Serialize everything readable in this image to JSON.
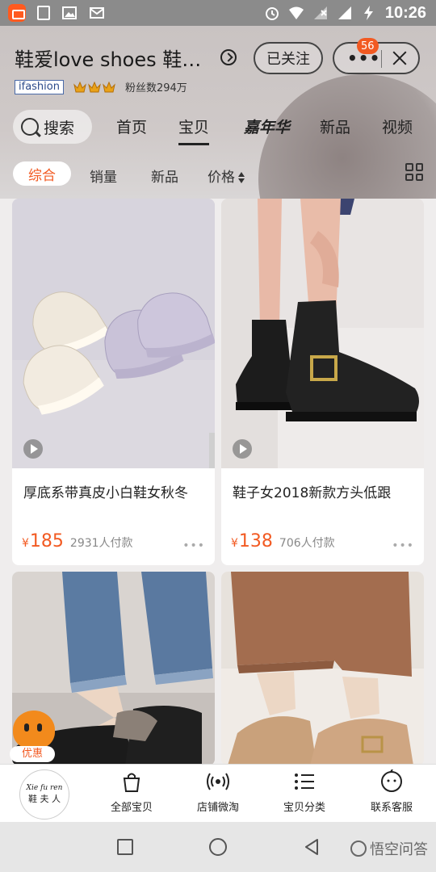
{
  "status_bar": {
    "time": "10:26"
  },
  "store": {
    "name": "鞋爱love shoes 鞋夫人",
    "follow_label": "已关注",
    "badge_count": "56",
    "tag": "ifashion",
    "fans": "粉丝数294万"
  },
  "nav": {
    "search": "搜索",
    "tabs": [
      "首页",
      "宝贝",
      "嘉年华",
      "新品",
      "视频"
    ],
    "active_tab": "宝贝"
  },
  "sort": {
    "items": [
      "综合",
      "销量",
      "新品",
      "价格"
    ],
    "active": "综合"
  },
  "products": [
    {
      "title": "厚底系带真皮小白鞋女秋冬",
      "currency": "¥",
      "price": "185",
      "sold": "2931人付款",
      "has_video": true
    },
    {
      "title": "鞋子女2018新款方头低跟",
      "currency": "¥",
      "price": "138",
      "sold": "706人付款",
      "has_video": true
    },
    {
      "title": "",
      "currency": "",
      "price": "",
      "sold": "",
      "has_video": false
    },
    {
      "title": "",
      "currency": "",
      "price": "",
      "sold": "",
      "has_video": false
    }
  ],
  "coupon": {
    "label": "优惠"
  },
  "bottom_tabs": {
    "logo_script": "Xie fu ren",
    "logo_text": "鞋 夫 人",
    "items": [
      {
        "label": "全部宝贝",
        "icon": "bag-icon"
      },
      {
        "label": "店铺微淘",
        "icon": "broadcast-icon"
      },
      {
        "label": "宝贝分类",
        "icon": "list-icon"
      },
      {
        "label": "联系客服",
        "icon": "chat-bot-icon"
      }
    ]
  },
  "watermark": "悟空问答",
  "colors": {
    "accent": "#f25a22",
    "status_bar": "#8b8b8b"
  }
}
